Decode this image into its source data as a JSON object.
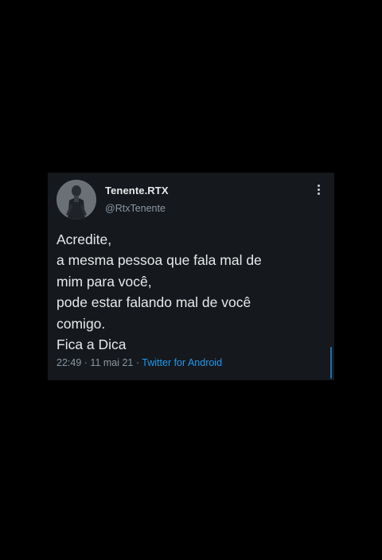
{
  "tweet": {
    "display_name": "Tenente.RTX",
    "handle": "@RtxTenente",
    "text_lines": [
      "Acredite,",
      "a mesma pessoa que fala mal de",
      "mim para você,",
      "pode estar falando mal de você",
      "comigo.",
      "Fica a Dica"
    ],
    "time": "22:49",
    "date": "11 mai 21",
    "separator": "·",
    "source": "Twitter for Android",
    "more_icon": "vertical-ellipsis-icon"
  },
  "colors": {
    "background": "#000000",
    "card": "#15181c",
    "text": "#e7e9ea",
    "muted": "#8b98a5",
    "accent": "#1d9bf0"
  }
}
